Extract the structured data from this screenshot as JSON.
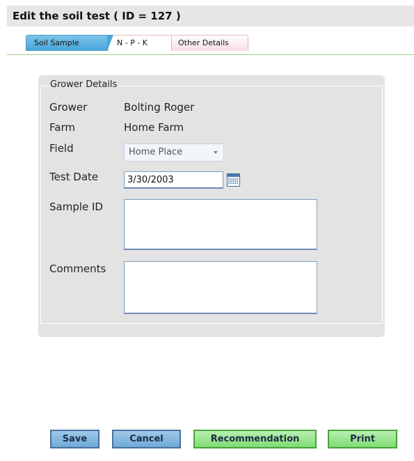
{
  "header": {
    "title": "Edit the soil test ( ID = 127 )"
  },
  "tabs": [
    {
      "label": "Soil Sample",
      "active": true
    },
    {
      "label": "N - P - K",
      "active": false
    },
    {
      "label": "Other Details",
      "active": false
    }
  ],
  "grower_details": {
    "legend": "Grower Details",
    "grower_label": "Grower",
    "grower_value": "Bolting Roger",
    "farm_label": "Farm",
    "farm_value": "Home Farm",
    "field_label": "Field",
    "field_selected": "Home Place",
    "test_date_label": "Test Date",
    "test_date_value": "3/30/2003",
    "sample_id_label": "Sample ID",
    "sample_id_value": "",
    "comments_label": "Comments",
    "comments_value": ""
  },
  "buttons": {
    "save": "Save",
    "cancel": "Cancel",
    "recommendation": "Recommendation",
    "print": "Print"
  },
  "icons": {
    "calendar": "calendar-icon",
    "dropdown": "chevron-down-icon"
  },
  "colors": {
    "active_tab": "#4aa6da",
    "blue_button": "#6eaad8",
    "green_button": "#7fdc74"
  }
}
